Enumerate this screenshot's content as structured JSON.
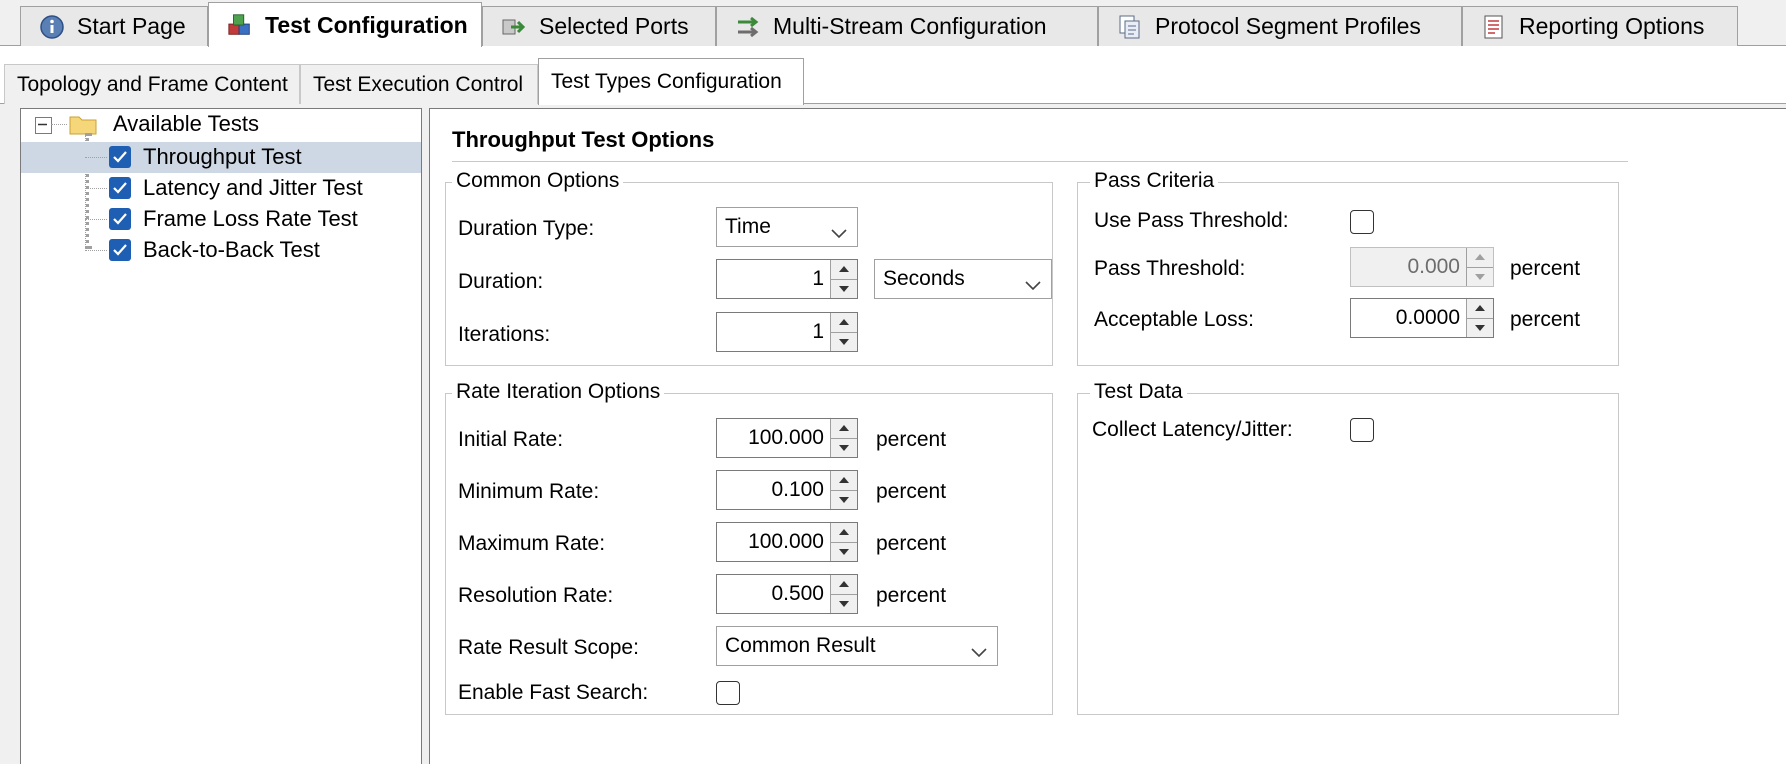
{
  "top_tabs": [
    {
      "label": "Start Page",
      "icon": "info-icon"
    },
    {
      "label": "Test Configuration",
      "icon": "cube-config-icon",
      "active": true
    },
    {
      "label": "Selected Ports",
      "icon": "port-arrow-icon"
    },
    {
      "label": "Multi-Stream Configuration",
      "icon": "multi-stream-icon"
    },
    {
      "label": "Protocol Segment Profiles",
      "icon": "profile-pages-icon"
    },
    {
      "label": "Reporting Options",
      "icon": "report-icon"
    }
  ],
  "sub_tabs": [
    {
      "label": "Topology and Frame Content"
    },
    {
      "label": "Test Execution Control"
    },
    {
      "label": "Test Types Configuration",
      "active": true
    }
  ],
  "tree": {
    "root": "Available Tests",
    "items": [
      {
        "label": "Throughput Test",
        "checked": true,
        "selected": true
      },
      {
        "label": "Latency and Jitter Test",
        "checked": true
      },
      {
        "label": "Frame Loss Rate Test",
        "checked": true
      },
      {
        "label": "Back-to-Back Test",
        "checked": true
      }
    ]
  },
  "panel": {
    "title": "Throughput Test Options",
    "common": {
      "title": "Common Options",
      "duration_type_label": "Duration Type:",
      "duration_type_value": "Time",
      "duration_label": "Duration:",
      "duration_value": "1",
      "duration_unit": "Seconds",
      "iterations_label": "Iterations:",
      "iterations_value": "1"
    },
    "pass": {
      "title": "Pass Criteria",
      "use_threshold_label": "Use Pass Threshold:",
      "threshold_label": "Pass Threshold:",
      "threshold_value": "0.000",
      "threshold_unit": "percent",
      "loss_label": "Acceptable Loss:",
      "loss_value": "0.0000",
      "loss_unit": "percent"
    },
    "rate": {
      "title": "Rate Iteration Options",
      "initial_label": "Initial Rate:",
      "initial_value": "100.000",
      "min_label": "Minimum Rate:",
      "min_value": "0.100",
      "max_label": "Maximum Rate:",
      "max_value": "100.000",
      "res_label": "Resolution Rate:",
      "res_value": "0.500",
      "unit": "percent",
      "scope_label": "Rate Result Scope:",
      "scope_value": "Common Result",
      "fast_label": "Enable Fast Search:"
    },
    "testdata": {
      "title": "Test Data",
      "collect_label": "Collect Latency/Jitter:"
    }
  }
}
